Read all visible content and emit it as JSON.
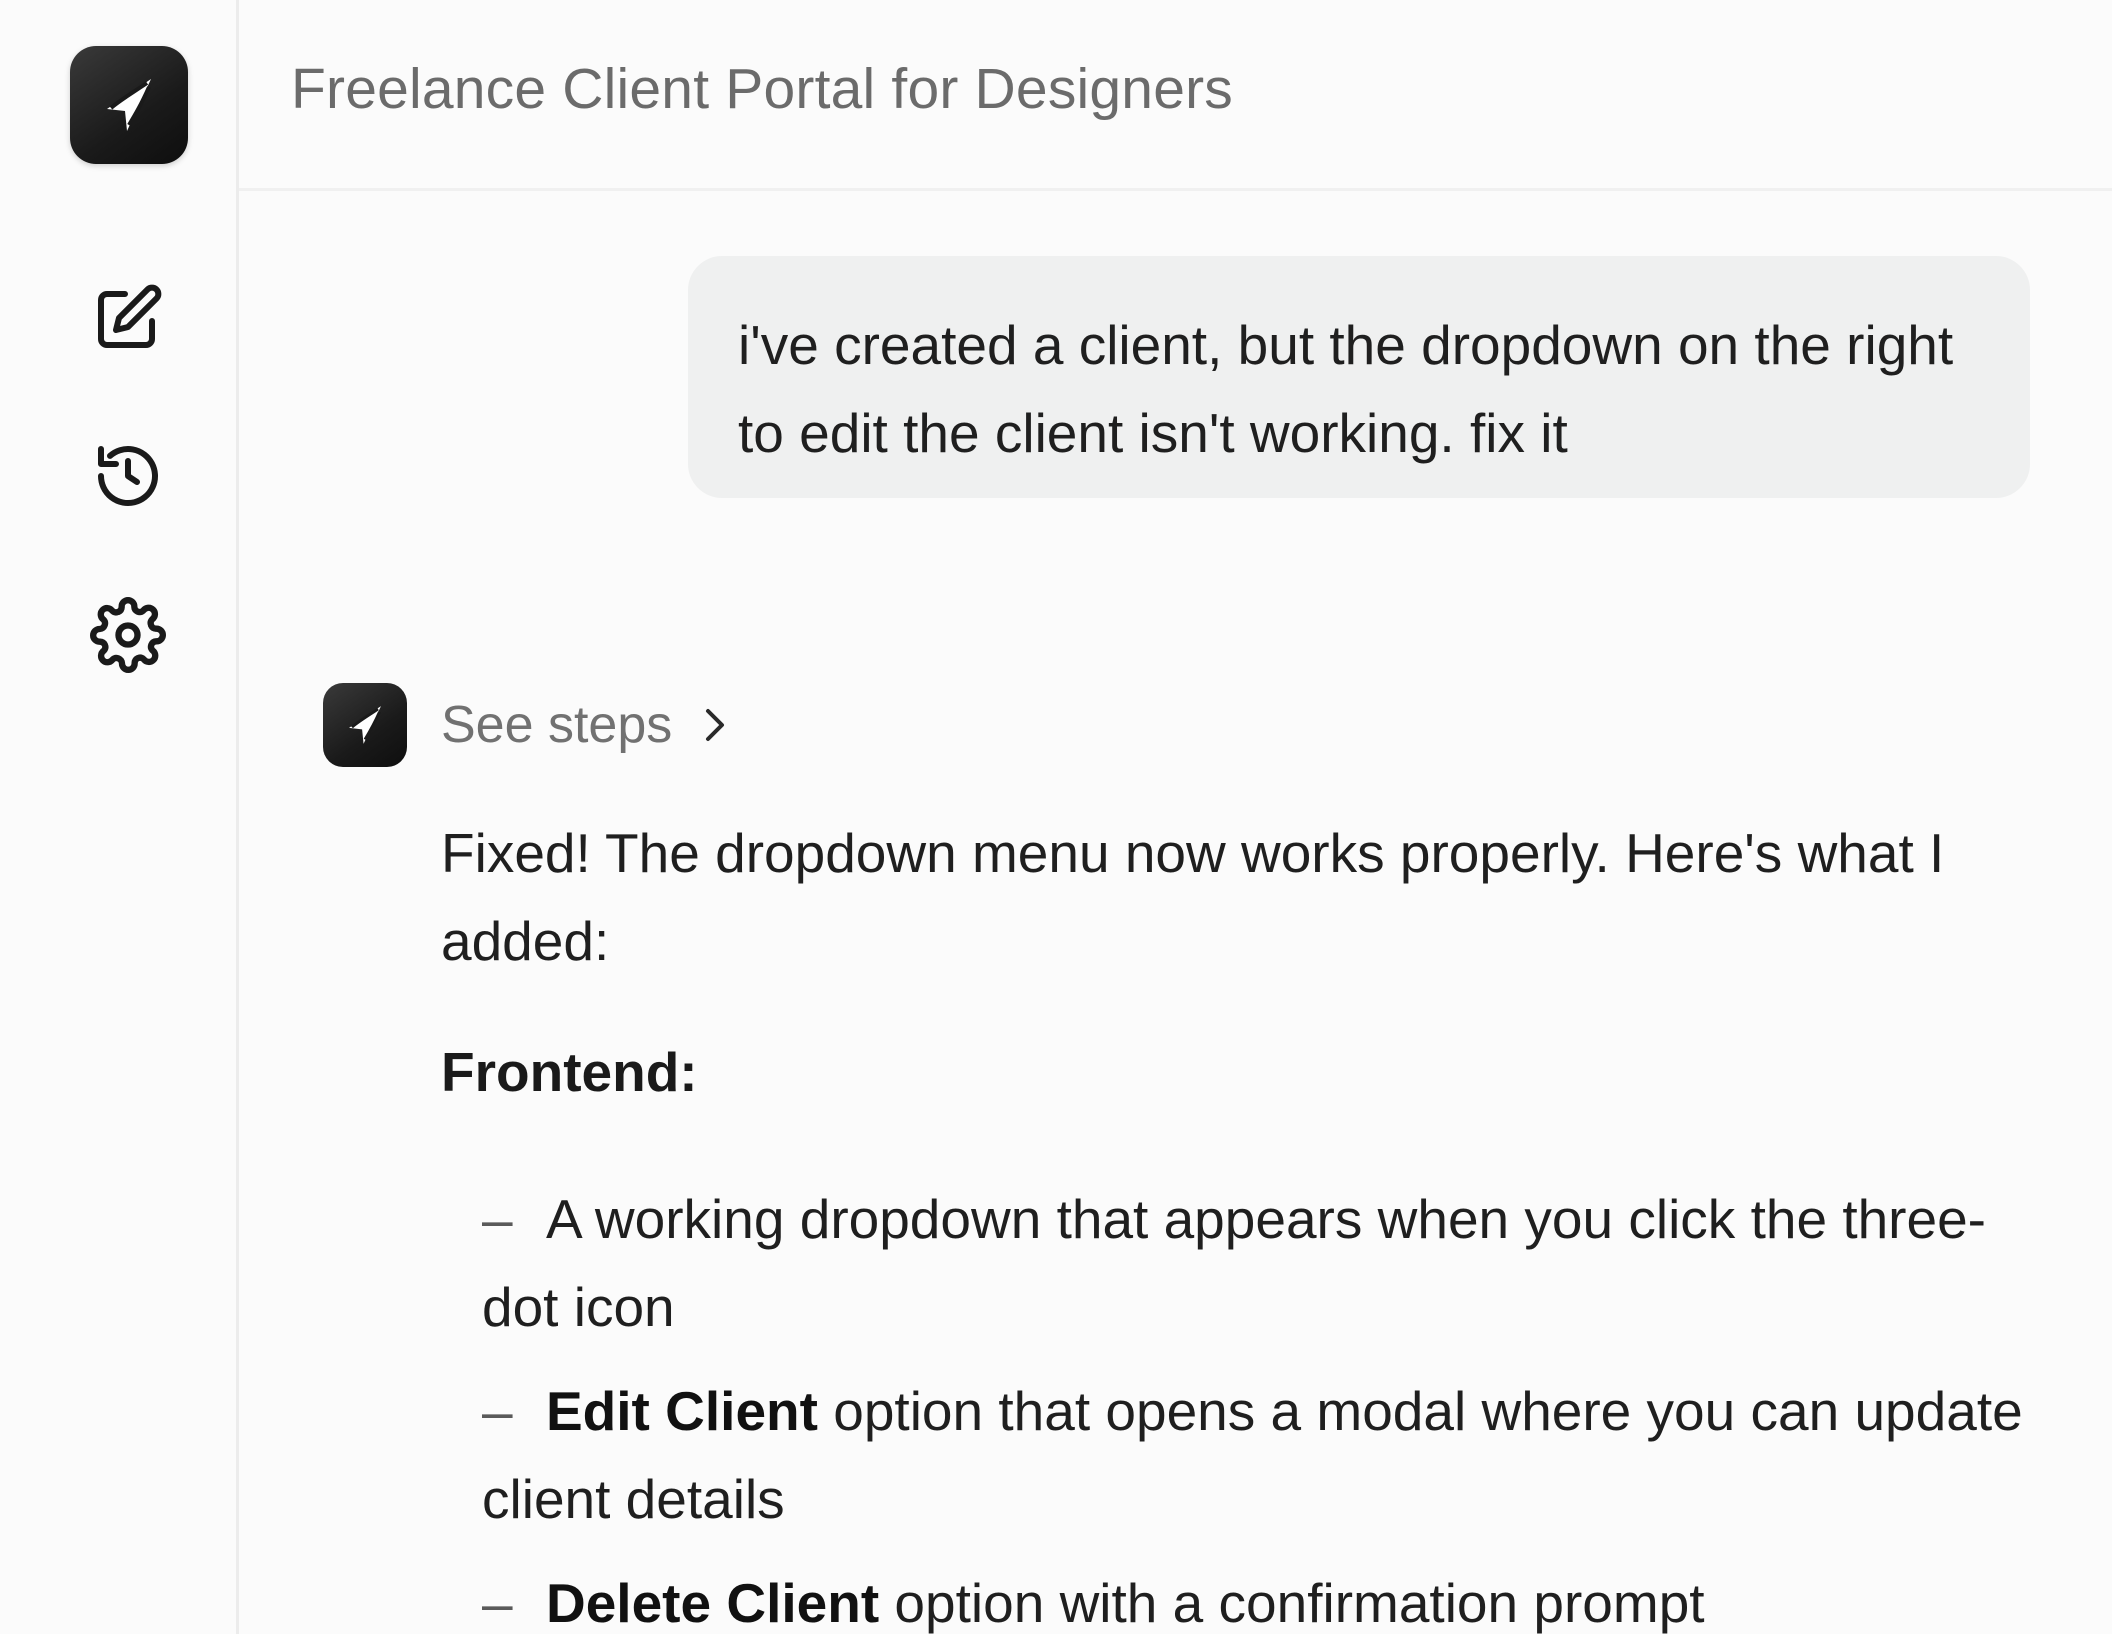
{
  "header": {
    "title": "Freelance Client Portal for Designers"
  },
  "sidebar": {
    "logo_icon": "brand-logo-icon",
    "items": [
      {
        "icon": "new-chat-icon"
      },
      {
        "icon": "history-icon"
      },
      {
        "icon": "settings-icon"
      }
    ]
  },
  "user_message": {
    "text": "i've created a client, but the dropdown on the right to edit the client isn't working. fix it"
  },
  "assistant": {
    "see_steps_label": "See steps",
    "intro": "Fixed! The dropdown menu now works properly. Here's what I added:",
    "section_heading": "Frontend:",
    "bullets": [
      {
        "bold": "",
        "text": "A working dropdown that appears when you click the three-dot icon"
      },
      {
        "bold": "Edit Client",
        "text": " option that opens a modal where you can update client details"
      },
      {
        "bold": "Delete Client",
        "text": " option with a confirmation prompt"
      }
    ]
  },
  "colors": {
    "background": "#fbfbfb",
    "bubble": "#eff0f0",
    "muted_text": "#6b6b6b",
    "logo_dark": "#1a1a1a"
  }
}
